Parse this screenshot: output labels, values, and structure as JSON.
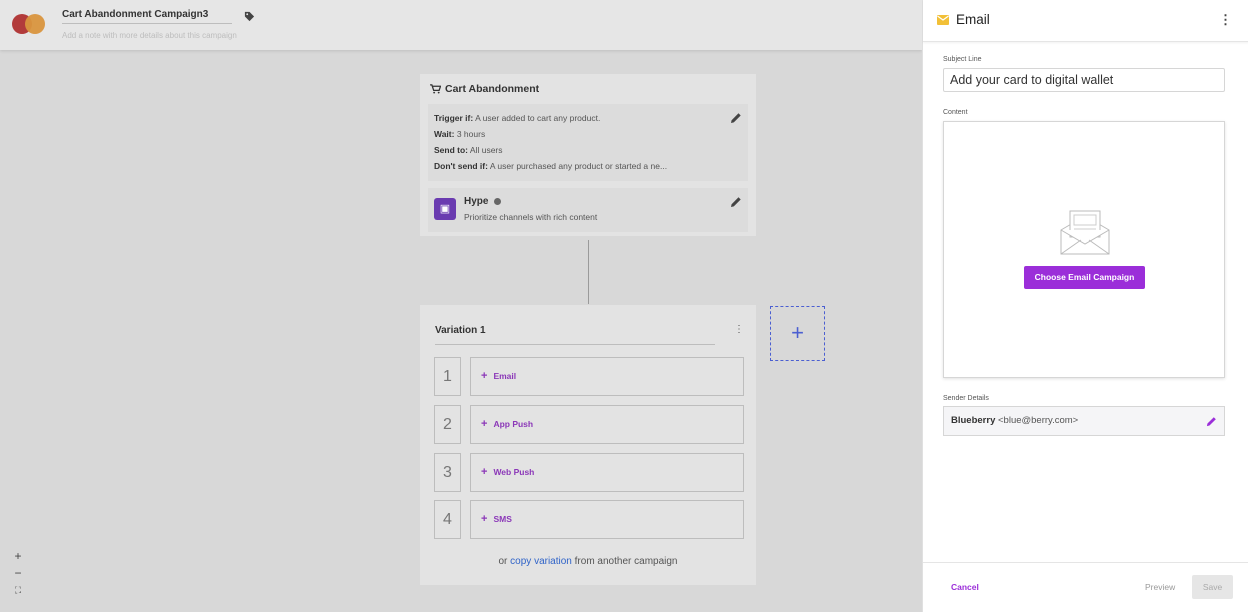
{
  "header": {
    "campaign_title": "Cart Abandonment Campaign3",
    "note_placeholder": "Add a note with more details about this campaign"
  },
  "trigger_card": {
    "title": "Cart Abandonment",
    "rules": [
      {
        "label": "Trigger if:",
        "value": "A user added to cart any product."
      },
      {
        "label": "Wait:",
        "value": "3 hours"
      },
      {
        "label": "Send to:",
        "value": "All users"
      },
      {
        "label": "Don't send if:",
        "value": "A user purchased any product or started a ne..."
      }
    ],
    "hype": {
      "title": "Hype",
      "subtitle": "Prioritize channels with rich content"
    }
  },
  "variation": {
    "title": "Variation 1",
    "steps": [
      {
        "number": "1",
        "label": "Email"
      },
      {
        "number": "2",
        "label": "App Push"
      },
      {
        "number": "3",
        "label": "Web Push"
      },
      {
        "number": "4",
        "label": "SMS"
      }
    ],
    "copy_prefix": "or",
    "copy_link": "copy variation",
    "copy_suffix": "from another campaign"
  },
  "add_variation_glyph": "+",
  "zoom": {
    "in": "+",
    "out": "−",
    "fit": "⛶"
  },
  "panel": {
    "title": "Email",
    "subject_label": "Subject Line",
    "subject_value": "Add your card to digital wallet",
    "content_label": "Content",
    "choose_button": "Choose Email Campaign",
    "sender_label": "Sender Details",
    "sender_name": "Blueberry",
    "sender_email": "<blue@berry.com>",
    "cancel": "Cancel",
    "preview": "Preview",
    "save": "Save"
  },
  "colors": {
    "accent": "#9b2ed9",
    "link": "#2f63c8",
    "add_variation": "#4b5fd1",
    "mail_icon": "#f2c037"
  },
  "icons": [
    "tag-icon",
    "cart-icon",
    "edit-icon",
    "info-icon",
    "hype-logo-icon",
    "plus-icon",
    "kebab-icon",
    "mail-icon",
    "envelope-illustration-icon"
  ]
}
